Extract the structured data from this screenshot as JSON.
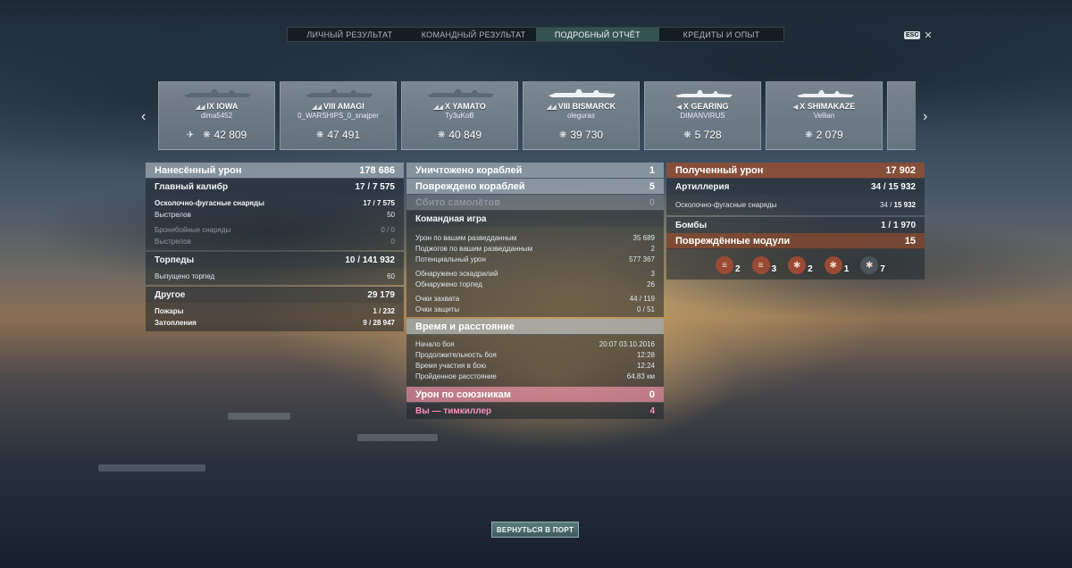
{
  "tabs": [
    {
      "label": "ЛИЧНЫЙ РЕЗУЛЬТАТ"
    },
    {
      "label": "КОМАНДНЫЙ РЕЗУЛЬТАТ"
    },
    {
      "label": "ПОДРОБНЫЙ ОТЧЁТ"
    },
    {
      "label": "КРЕДИТЫ И ОПЫТ"
    }
  ],
  "esc": {
    "key": "ESC",
    "close": "✕"
  },
  "nav": {
    "prev": "‹",
    "next": "›"
  },
  "ships": [
    {
      "tier": "IX",
      "name": "IOWA",
      "player": "dima5452",
      "damage": "42 809",
      "prefix": "◢◢"
    },
    {
      "tier": "VIII",
      "name": "AMAGI",
      "player": "0_WARSHIPS_0_snajper",
      "damage": "47 491",
      "prefix": "◢◢"
    },
    {
      "tier": "X",
      "name": "YAMATO",
      "player": "Ty3uKoB",
      "damage": "40 849",
      "prefix": "◢◢"
    },
    {
      "tier": "VIII",
      "name": "BISMARCK",
      "player": "oleguras",
      "damage": "39 730",
      "prefix": "◢◢"
    },
    {
      "tier": "X",
      "name": "GEARING",
      "player": "DIMANVIRUS",
      "damage": "5 728",
      "prefix": "◀"
    },
    {
      "tier": "X",
      "name": "SHIMAKAZE",
      "player": "Vellian",
      "damage": "2 079",
      "prefix": "◀"
    }
  ],
  "left": {
    "dealt": {
      "label": "Нанесённый урон",
      "value": "178 686"
    },
    "main": {
      "label": "Главный калибр",
      "value_a": "17 /",
      "value_b": "7 575"
    },
    "he": {
      "label": "Осколочно-фугасные снаряды",
      "value_a": "17 /",
      "value_b": "7 575"
    },
    "shots": {
      "label": "Выстрелов",
      "value": "50"
    },
    "ap": {
      "label": "Бронебойные снаряды",
      "value": "0 / 0"
    },
    "ap_shots": {
      "label": "Выстрелов",
      "value": "0"
    },
    "torps": {
      "label": "Торпеды",
      "value_a": "10 /",
      "value_b": "141 932"
    },
    "torps_fired": {
      "label": "Выпущено торпед",
      "value": "60"
    },
    "other": {
      "label": "Другое",
      "value": "29 179"
    },
    "fires": {
      "label": "Пожары",
      "value_a": "1 /",
      "value_b": "232"
    },
    "floods": {
      "label": "Затопления",
      "value_a": "9 /",
      "value_b": "28 947"
    }
  },
  "center": {
    "destroyed": {
      "label": "Уничтожено кораблей",
      "value": "1"
    },
    "damaged": {
      "label": "Повреждено кораблей",
      "value": "5"
    },
    "planes": {
      "label": "Сбито самолётов",
      "value": "0"
    },
    "team": {
      "label": "Командная игра"
    },
    "team_rows": [
      {
        "label": "Урон по вашим разведданным",
        "value": "35 689"
      },
      {
        "label": "Поджогов по вашим разведданным",
        "value": "2"
      },
      {
        "label": "Потенциальный урон",
        "value": "577 367"
      },
      {
        "label": "Обнаружено эскадрилий",
        "value": "3"
      },
      {
        "label": "Обнаружено торпед",
        "value": "26"
      },
      {
        "label": "Очки захвата",
        "value": "44 / 119"
      },
      {
        "label": "Очки защиты",
        "value": "0 / 51"
      }
    ],
    "time": {
      "label": "Время и расстояние"
    },
    "time_rows": [
      {
        "label": "Начало боя",
        "value": "20:07  03.10.2016"
      },
      {
        "label": "Продолжительность боя",
        "value": "12:28"
      },
      {
        "label": "Время участия в бою",
        "value": "12:24"
      },
      {
        "label": "Пройденное расстояние",
        "value": "64.83 км"
      }
    ],
    "allies": {
      "label": "Урон по союзникам",
      "value": "0"
    },
    "teamkiller": {
      "label": "Вы — тимкиллер",
      "value": "4"
    }
  },
  "right": {
    "received": {
      "label": "Полученный урон",
      "value": "17 902"
    },
    "artillery": {
      "label": "Артиллерия",
      "value_a": "34 /",
      "value_b": "15 932"
    },
    "he": {
      "label": "Осколочно-фугасные снаряды",
      "value_a": "34 /",
      "value_b": "15 932"
    },
    "bombs": {
      "label": "Бомбы",
      "value": "1 / 1 970"
    },
    "modules": {
      "label": "Повреждённые модули",
      "value": "15"
    },
    "module_icons": [
      {
        "icon": "turret-icon",
        "glyph": "≡",
        "count": "2"
      },
      {
        "icon": "torpedo-tube-icon",
        "glyph": "≡",
        "count": "3"
      },
      {
        "icon": "engine-icon",
        "glyph": "✱",
        "count": "2"
      },
      {
        "icon": "steering-gear-icon",
        "glyph": "✱",
        "count": "1"
      },
      {
        "icon": "aa-gun-icon",
        "glyph": "✱",
        "count": "7"
      }
    ]
  },
  "back_button": "ВЕРНУТЬСЯ В ПОРТ"
}
